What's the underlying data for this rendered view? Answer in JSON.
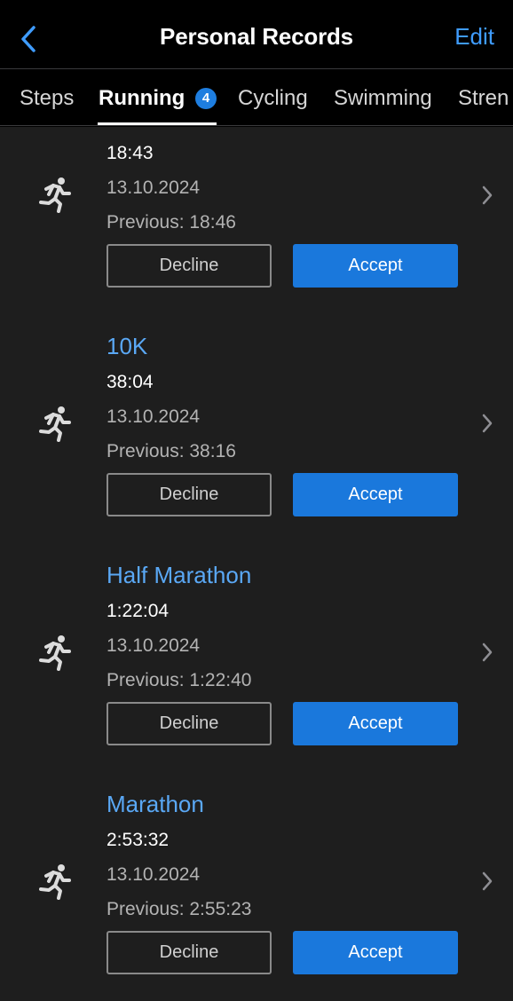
{
  "header": {
    "title": "Personal Records",
    "edit_label": "Edit"
  },
  "tabs": [
    {
      "label": "Steps"
    },
    {
      "label": "Running",
      "badge": "4"
    },
    {
      "label": "Cycling"
    },
    {
      "label": "Swimming"
    },
    {
      "label": "Stren"
    }
  ],
  "records": [
    {
      "name": "",
      "time": "18:43",
      "date": "13.10.2024",
      "previous": "Previous: 18:46",
      "decline_label": "Decline",
      "accept_label": "Accept"
    },
    {
      "name": "10K",
      "time": "38:04",
      "date": "13.10.2024",
      "previous": "Previous: 38:16",
      "decline_label": "Decline",
      "accept_label": "Accept"
    },
    {
      "name": "Half Marathon",
      "time": "1:22:04",
      "date": "13.10.2024",
      "previous": "Previous: 1:22:40",
      "decline_label": "Decline",
      "accept_label": "Accept"
    },
    {
      "name": "Marathon",
      "time": "2:53:32",
      "date": "13.10.2024",
      "previous": "Previous: 2:55:23",
      "decline_label": "Decline",
      "accept_label": "Accept"
    }
  ],
  "colors": {
    "accent": "#3f9cff",
    "accept_button": "#1a78dc",
    "list_background": "#1e1e1e",
    "record_name": "#5aa8f5"
  },
  "icons": {
    "back": "chevron-left-icon",
    "record": "running-icon",
    "row": "chevron-right-icon"
  }
}
